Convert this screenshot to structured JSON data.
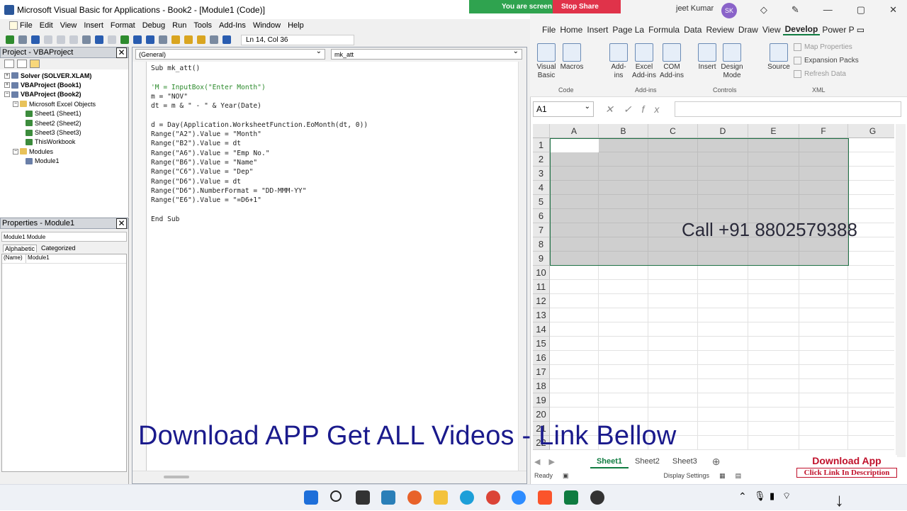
{
  "vbe": {
    "title": "Microsoft Visual Basic for Applications - Book2 - [Module1 (Code)]",
    "menu": [
      "File",
      "Edit",
      "View",
      "Insert",
      "Format",
      "Debug",
      "Run",
      "Tools",
      "Add-Ins",
      "Window",
      "Help"
    ],
    "position": "Ln 14, Col 36",
    "project_title": "Project - VBAProject",
    "tree": [
      {
        "label": "Solver (SOLVER.XLAM)",
        "bold": true
      },
      {
        "label": "VBAProject (Book1)",
        "bold": true
      },
      {
        "label": "VBAProject (Book2)",
        "bold": true
      },
      {
        "label": "Microsoft Excel Objects",
        "bold": false
      },
      {
        "label": "Sheet1 (Sheet1)",
        "bold": false
      },
      {
        "label": "Sheet2 (Sheet2)",
        "bold": false
      },
      {
        "label": "Sheet3 (Sheet3)",
        "bold": false
      },
      {
        "label": "ThisWorkbook",
        "bold": false
      },
      {
        "label": "Modules",
        "bold": false
      },
      {
        "label": "Module1",
        "bold": false
      }
    ],
    "properties_title": "Properties - Module1",
    "properties_object": "Module1  Module",
    "properties_tabs": [
      "Alphabetic",
      "Categorized"
    ],
    "prop_name": "(Name)",
    "prop_value": "Module1",
    "object_dropdown": "(General)",
    "proc_dropdown": "mk_att",
    "code": [
      {
        "t": "Sub mk_att()",
        "c": false
      },
      {
        "t": "",
        "c": false
      },
      {
        "t": "'M = InputBox(\"Enter Month\")",
        "c": true
      },
      {
        "t": "m = \"NOV\"",
        "c": false
      },
      {
        "t": "dt = m & \" - \" & Year(Date)",
        "c": false
      },
      {
        "t": "",
        "c": false
      },
      {
        "t": "d = Day(Application.WorksheetFunction.EoMonth(dt, 0))",
        "c": false
      },
      {
        "t": "Range(\"A2\").Value = \"Month\"",
        "c": false
      },
      {
        "t": "Range(\"B2\").Value = dt",
        "c": false
      },
      {
        "t": "Range(\"A6\").Value = \"Emp No.\"",
        "c": false
      },
      {
        "t": "Range(\"B6\").Value = \"Name\"",
        "c": false
      },
      {
        "t": "Range(\"C6\").Value = \"Dep\"",
        "c": false
      },
      {
        "t": "Range(\"D6\").Value = dt",
        "c": false
      },
      {
        "t": "Range(\"D6\").NumberFormat = \"DD-MMM-YY\"",
        "c": false
      },
      {
        "t": "Range(\"E6\").Value = \"=D6+1\"",
        "c": false
      },
      {
        "t": "",
        "c": false
      },
      {
        "t": "End Sub",
        "c": false
      }
    ]
  },
  "banner": "Download APP Get ALL Videos -  Link Bellow",
  "share": {
    "text": "You are screen sharing",
    "stop": "Stop Share"
  },
  "user": {
    "name": "jeet Kumar",
    "initials": "SK"
  },
  "excel": {
    "tabs": [
      "File",
      "Home",
      "Insert",
      "Page La",
      "Formula",
      "Data",
      "Review",
      "Draw",
      "View",
      "Develop",
      "Power P"
    ],
    "active_tab": "Develop",
    "ribbon": {
      "visual_basic": "Visual Basic",
      "macros": "Macros",
      "addins": "Add-ins",
      "excel_addins": "Excel Add-ins",
      "com_addins": "COM Add-ins",
      "insert": "Insert",
      "design_mode": "Design Mode",
      "source": "Source",
      "map_properties": "Map Properties",
      "expansion_packs": "Expansion Packs",
      "refresh_data": "Refresh Data",
      "group_code": "Code",
      "group_addins": "Add-ins",
      "group_controls": "Controls",
      "group_xml": "XML"
    },
    "name_box": "A1",
    "columns": [
      "A",
      "B",
      "C",
      "D",
      "E",
      "F",
      "G"
    ],
    "rows": [
      "1",
      "2",
      "3",
      "4",
      "5",
      "6",
      "7",
      "8",
      "9",
      "10",
      "11",
      "12",
      "13",
      "14",
      "15",
      "16",
      "17",
      "18",
      "19",
      "20",
      "21",
      "22"
    ],
    "call_text": "Call +91 8802579388",
    "sheets": [
      "Sheet1",
      "Sheet2",
      "Sheet3"
    ],
    "status": "Ready",
    "display_settings": "Display Settings",
    "download_app": "Download App",
    "click_link": "Click Link In Description"
  },
  "colors": {
    "excel_green": "#107c41",
    "share_green": "#2fa34f",
    "stop_red": "#e0334a",
    "banner_navy": "#1a1a8c"
  }
}
